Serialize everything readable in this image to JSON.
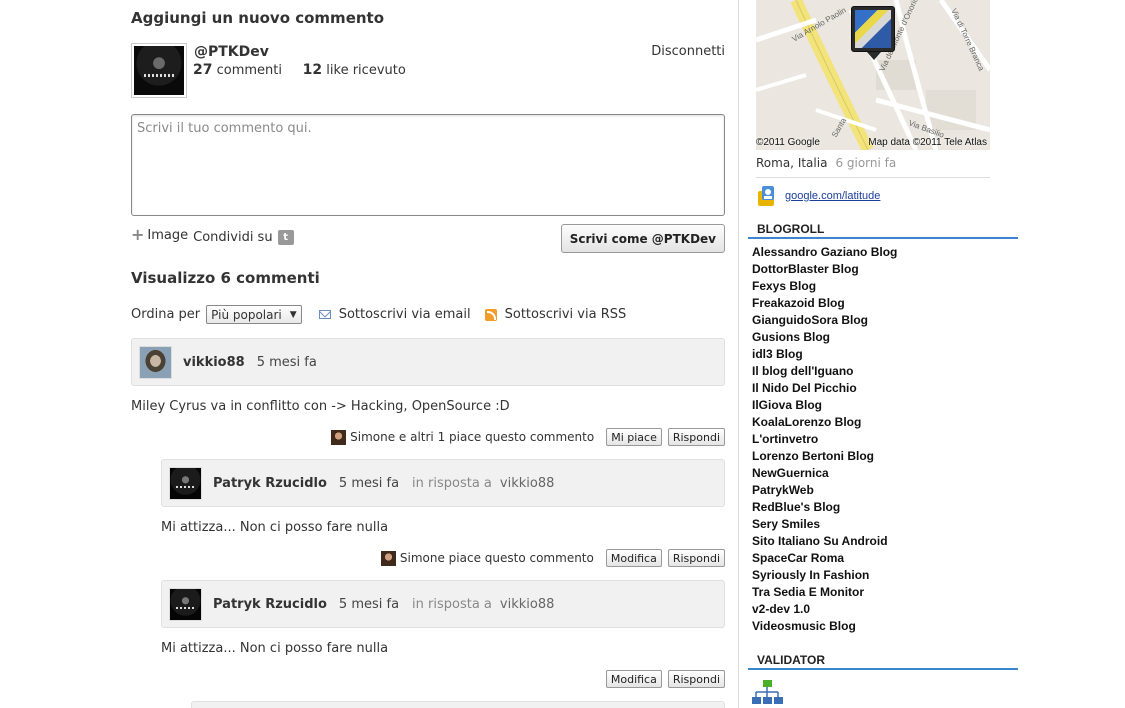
{
  "compose": {
    "heading": "Aggiungi un nuovo commento",
    "username": "@PTKDev",
    "comments_count": "27",
    "comments_label": "commenti",
    "likes_count": "12",
    "likes_label": "like ricevuto",
    "logout_label": "Disconnetti",
    "placeholder": "Scrivi il tuo commento qui.",
    "image_label": "Image",
    "share_label": "Condividi su",
    "submit_label": "Scrivi come @PTKDev"
  },
  "listing": {
    "heading": "Visualizzo 6 commenti",
    "sort_label": "Ordina per",
    "sort_value": "Più popolari",
    "subscribe_email": "Sottoscrivi via email",
    "subscribe_rss": "Sottoscrivi via RSS"
  },
  "comments": [
    {
      "author": "vikkio88",
      "time": "5 mesi fa",
      "text": "Miley Cyrus va in conflitto con -> Hacking, OpenSource :D",
      "likes_text": "Simone e altri 1 piace questo commento",
      "like_button": "Mi piace",
      "reply_button": "Rispondi"
    },
    {
      "author": "Patryk Rzucidlo",
      "time": "5 mesi fa",
      "reply_label": "in risposta a",
      "reply_to": "vikkio88",
      "text": "Mi attizza... Non ci posso fare nulla",
      "likes_text": "Simone piace questo commento",
      "edit_button": "Modifica",
      "reply_button": "Rispondi"
    },
    {
      "author": "Patryk Rzucidlo",
      "time": "5 mesi fa",
      "reply_label": "in risposta a",
      "reply_to": "vikkio88",
      "text": "Mi attizza... Non ci posso fare nulla",
      "edit_button": "Modifica",
      "reply_button": "Rispondi"
    }
  ],
  "sidebar": {
    "map": {
      "attribution_left": "©2011 Google",
      "attribution_right": "Map data ©2011 Tele Atlas",
      "streets": [
        "Via Arnolo Paolin",
        "Via del Monte d'Onorio",
        "Via di Torre Branca",
        "Via Basilio",
        "Santa"
      ]
    },
    "location": "Roma, Italia",
    "location_time": "6 giorni fa",
    "latitude_link": "google.com/latitude",
    "blogroll_title": "BLOGROLL",
    "blogroll": [
      "Alessandro Gaziano Blog",
      "DottorBlaster Blog",
      "Fexys Blog",
      "Freakazoid Blog",
      "GianguidoSora Blog",
      "Gusions Blog",
      "idl3 Blog",
      "Il blog dell'Iguano",
      "Il Nido Del Picchio",
      "IlGiova Blog",
      "KoalaLorenzo Blog",
      "L'ortinvetro",
      "Lorenzo Bertoni Blog",
      "NewGuernica",
      "PatrykWeb",
      "RedBlue's Blog",
      "Sery Smiles",
      "Sito Italiano Su Android",
      "SpaceCar Roma",
      "Syriously In Fashion",
      "Tra Sedia E Monitor",
      "v2-dev 1.0",
      "Videosmusic Blog"
    ],
    "validator_title": "VALIDATOR"
  },
  "colors": {
    "accent_blue": "#3a86d1",
    "link": "#1a3e9a",
    "rss": "#f39c2a",
    "map_road": "#f2e37a"
  }
}
